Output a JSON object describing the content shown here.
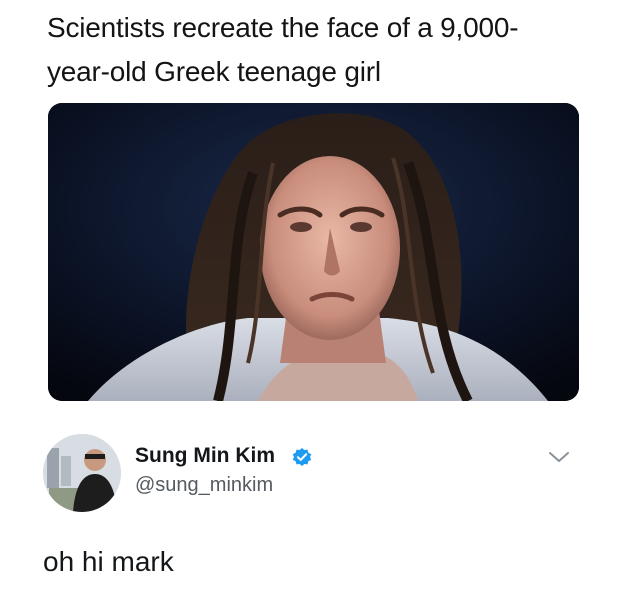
{
  "post": {
    "headline_line1": "Scientists recreate the face of a 9,000-",
    "headline_line2": "year-old Greek teenage girl",
    "photo_icon": "reconstructed-face-photo"
  },
  "tweet": {
    "display_name": "Sung Min Kim",
    "handle": "@sung_minkim",
    "verified_icon": "verified-badge-icon",
    "menu_icon": "chevron-down-icon",
    "text": "oh hi mark"
  },
  "colors": {
    "verified_blue": "#1d9bf0",
    "text_dark": "#14171a",
    "handle_gray": "#555b61"
  }
}
